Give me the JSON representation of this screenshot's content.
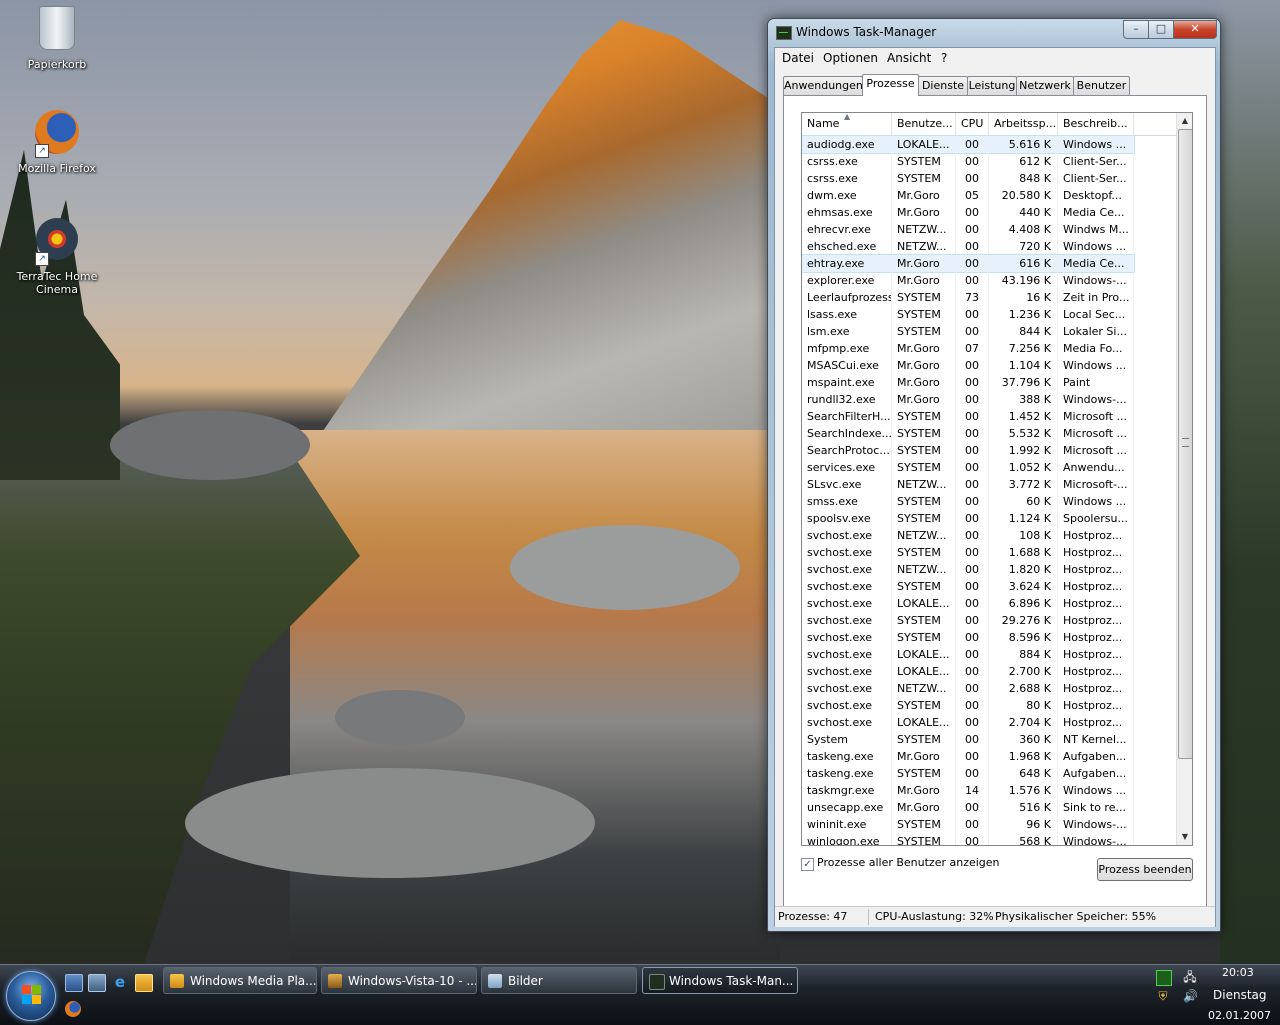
{
  "desktop": {
    "icons": [
      {
        "label": "Papierkorb"
      },
      {
        "label": "Mozilla Firefox"
      },
      {
        "label": "TerraTec Home Cinema"
      }
    ]
  },
  "taskmanager": {
    "title": "Windows Task-Manager",
    "menu": [
      "Datei",
      "Optionen",
      "Ansicht",
      "?"
    ],
    "tabs": [
      "Anwendungen",
      "Prozesse",
      "Dienste",
      "Leistung",
      "Netzwerk",
      "Benutzer"
    ],
    "active_tab": "Prozesse",
    "columns": [
      "Name",
      "Benutze...",
      "CPU",
      "Arbeitssp...",
      "Beschreib..."
    ],
    "rows": [
      [
        "audiodg.exe",
        "LOKALE...",
        "00",
        "5.616 K",
        "Windows ..."
      ],
      [
        "csrss.exe",
        "SYSTEM",
        "00",
        "612 K",
        "Client-Ser..."
      ],
      [
        "csrss.exe",
        "SYSTEM",
        "00",
        "848 K",
        "Client-Ser..."
      ],
      [
        "dwm.exe",
        "Mr.Goro",
        "05",
        "20.580 K",
        "Desktopf..."
      ],
      [
        "ehmsas.exe",
        "Mr.Goro",
        "00",
        "440 K",
        "Media Ce..."
      ],
      [
        "ehrecvr.exe",
        "NETZW...",
        "00",
        "4.408 K",
        "Windws M..."
      ],
      [
        "ehsched.exe",
        "NETZW...",
        "00",
        "720 K",
        "Windows ..."
      ],
      [
        "ehtray.exe",
        "Mr.Goro",
        "00",
        "616 K",
        "Media Ce..."
      ],
      [
        "explorer.exe",
        "Mr.Goro",
        "00",
        "43.196 K",
        "Windows-..."
      ],
      [
        "Leerlaufprozess",
        "SYSTEM",
        "73",
        "16 K",
        "Zeit in Pro..."
      ],
      [
        "lsass.exe",
        "SYSTEM",
        "00",
        "1.236 K",
        "Local Sec..."
      ],
      [
        "lsm.exe",
        "SYSTEM",
        "00",
        "844 K",
        "Lokaler Si..."
      ],
      [
        "mfpmp.exe",
        "Mr.Goro",
        "07",
        "7.256 K",
        "Media Fo..."
      ],
      [
        "MSASCui.exe",
        "Mr.Goro",
        "00",
        "1.104 K",
        "Windows ..."
      ],
      [
        "mspaint.exe",
        "Mr.Goro",
        "00",
        "37.796 K",
        "Paint"
      ],
      [
        "rundll32.exe",
        "Mr.Goro",
        "00",
        "388 K",
        "Windows-..."
      ],
      [
        "SearchFilterH...",
        "SYSTEM",
        "00",
        "1.452 K",
        "Microsoft ..."
      ],
      [
        "SearchIndexe...",
        "SYSTEM",
        "00",
        "5.532 K",
        "Microsoft ..."
      ],
      [
        "SearchProtoc...",
        "SYSTEM",
        "00",
        "1.992 K",
        "Microsoft ..."
      ],
      [
        "services.exe",
        "SYSTEM",
        "00",
        "1.052 K",
        "Anwendu..."
      ],
      [
        "SLsvc.exe",
        "NETZW...",
        "00",
        "3.772 K",
        "Microsoft-..."
      ],
      [
        "smss.exe",
        "SYSTEM",
        "00",
        "60 K",
        "Windows ..."
      ],
      [
        "spoolsv.exe",
        "SYSTEM",
        "00",
        "1.124 K",
        "Spoolersu..."
      ],
      [
        "svchost.exe",
        "NETZW...",
        "00",
        "108 K",
        "Hostproz..."
      ],
      [
        "svchost.exe",
        "SYSTEM",
        "00",
        "1.688 K",
        "Hostproz..."
      ],
      [
        "svchost.exe",
        "NETZW...",
        "00",
        "1.820 K",
        "Hostproz..."
      ],
      [
        "svchost.exe",
        "SYSTEM",
        "00",
        "3.624 K",
        "Hostproz..."
      ],
      [
        "svchost.exe",
        "LOKALE...",
        "00",
        "6.896 K",
        "Hostproz..."
      ],
      [
        "svchost.exe",
        "SYSTEM",
        "00",
        "29.276 K",
        "Hostproz..."
      ],
      [
        "svchost.exe",
        "SYSTEM",
        "00",
        "8.596 K",
        "Hostproz..."
      ],
      [
        "svchost.exe",
        "LOKALE...",
        "00",
        "884 K",
        "Hostproz..."
      ],
      [
        "svchost.exe",
        "LOKALE...",
        "00",
        "2.700 K",
        "Hostproz..."
      ],
      [
        "svchost.exe",
        "NETZW...",
        "00",
        "2.688 K",
        "Hostproz..."
      ],
      [
        "svchost.exe",
        "SYSTEM",
        "00",
        "80 K",
        "Hostproz..."
      ],
      [
        "svchost.exe",
        "LOKALE...",
        "00",
        "2.704 K",
        "Hostproz..."
      ],
      [
        "System",
        "SYSTEM",
        "00",
        "360 K",
        "NT Kernel..."
      ],
      [
        "taskeng.exe",
        "Mr.Goro",
        "00",
        "1.968 K",
        "Aufgaben..."
      ],
      [
        "taskeng.exe",
        "SYSTEM",
        "00",
        "648 K",
        "Aufgaben..."
      ],
      [
        "taskmgr.exe",
        "Mr.Goro",
        "14",
        "1.576 K",
        "Windows ..."
      ],
      [
        "unsecapp.exe",
        "Mr.Goro",
        "00",
        "516 K",
        "Sink to re..."
      ],
      [
        "wininit.exe",
        "SYSTEM",
        "00",
        "96 K",
        "Windows-..."
      ],
      [
        "winlogon.exe",
        "SYSTEM",
        "00",
        "568 K",
        "Windows-..."
      ]
    ],
    "selected_rows": [
      0,
      7
    ],
    "show_all_users_label": "Prozesse aller Benutzer anzeigen",
    "show_all_users_checked": true,
    "end_process_label": "Prozess beenden",
    "status": {
      "processes": "Prozesse: 47",
      "cpu": "CPU-Auslastung: 32%",
      "memory": "Physikalischer Speicher: 55%"
    }
  },
  "taskbar": {
    "buttons": [
      {
        "label": "Windows Media Pla...",
        "active": false
      },
      {
        "label": "Windows-Vista-10 - ...",
        "active": false
      },
      {
        "label": "Bilder",
        "active": false
      },
      {
        "label": "Windows Task-Man...",
        "active": true
      }
    ],
    "clock": {
      "time": "20:03",
      "day": "Dienstag",
      "date": "02.01.2007"
    }
  },
  "colors": {
    "selection": "#e6f1fb",
    "taskbar": "#1d232a",
    "close_button": "#c7442c"
  }
}
